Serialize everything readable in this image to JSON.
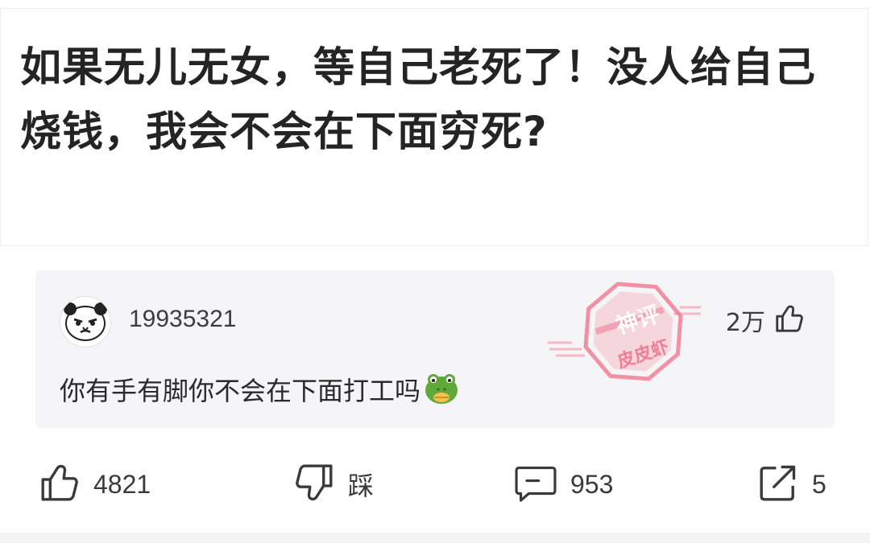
{
  "post": {
    "title": "如果无儿无女，等自己老死了！没人给自己烧钱，我会不会在下面穷死?"
  },
  "god_comment": {
    "username": "19935321",
    "like_count": "2万",
    "text": "你有手有脚你不会在下面打工吗",
    "stamp_top": "神评",
    "stamp_bottom": "皮皮虾",
    "stamp_color": "#f0738a"
  },
  "actions": {
    "like_count": "4821",
    "dislike_label": "踩",
    "comment_count": "953",
    "share_count": "5"
  },
  "icons": {
    "like": "thumbs-up-icon",
    "dislike": "thumbs-down-icon",
    "comment": "comment-bubble-icon",
    "share": "share-icon",
    "emoji": "frog-emoji-icon"
  }
}
